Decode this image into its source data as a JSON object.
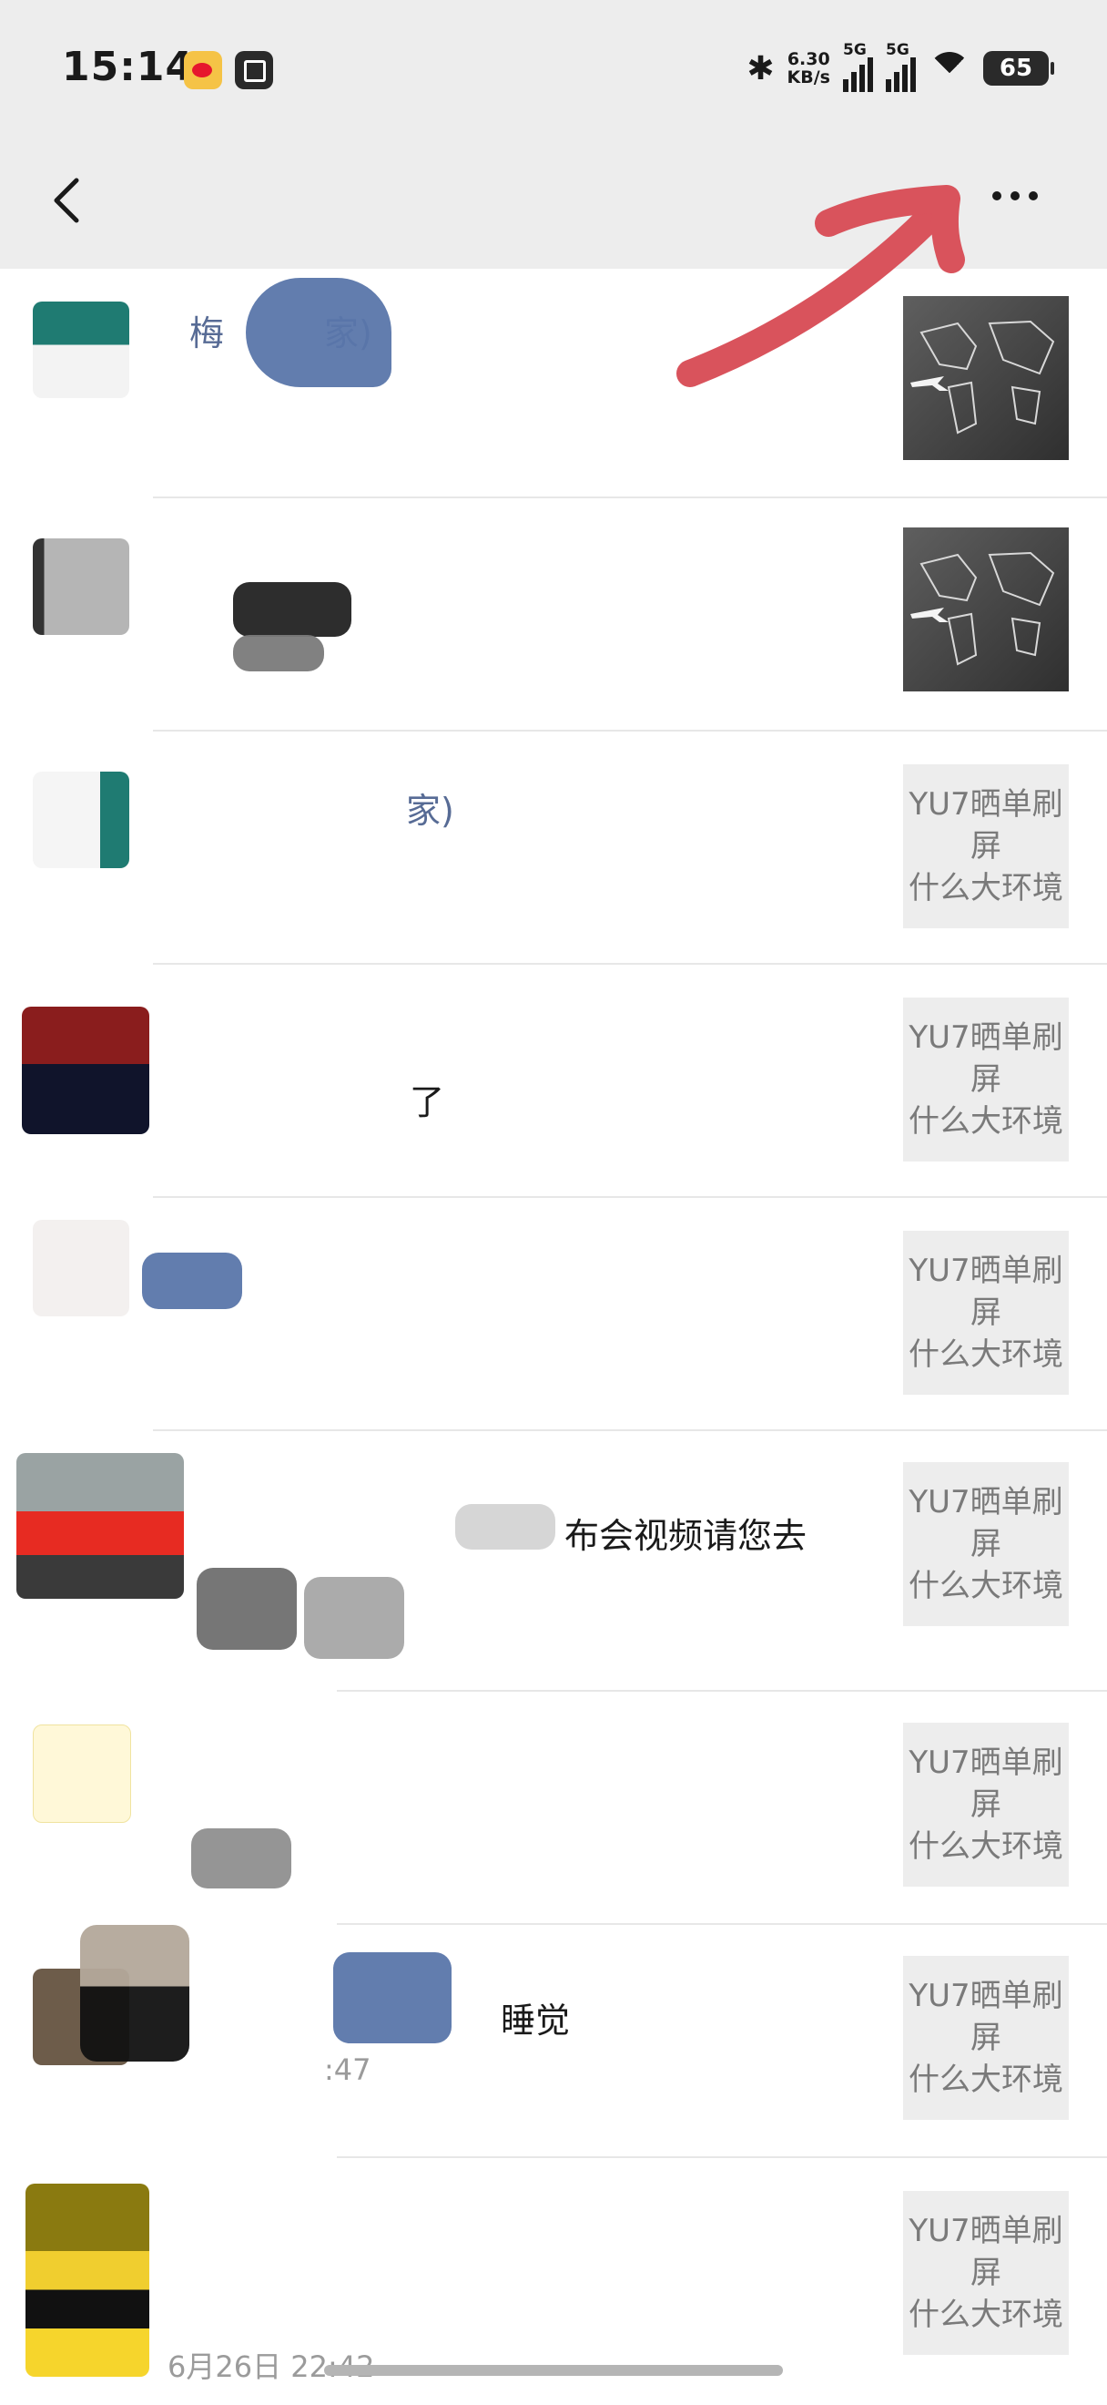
{
  "status_bar": {
    "time": "15:14",
    "bluetooth_icon": "✱",
    "net_speed_value": "6.30",
    "net_speed_unit": "KB/s",
    "signal_1_label": "5G",
    "signal_2_label": "5G",
    "battery": "65",
    "icons": [
      "weibo-icon",
      "notes-icon",
      "bluetooth-icon",
      "signal-icon",
      "wifi-icon",
      "battery-icon"
    ]
  },
  "nav": {
    "title": "",
    "back_icon": "chevron-left-icon",
    "more_icon": "more-dots-icon"
  },
  "messages": [
    {
      "name": "梅",
      "name_suffix": "家)",
      "text": "",
      "time": "",
      "thumb_type": "image",
      "thumb_text": ""
    },
    {
      "name": "",
      "name_suffix": "",
      "text": "",
      "time": "",
      "thumb_type": "image",
      "thumb_text": ""
    },
    {
      "name": "",
      "name_suffix": "家)",
      "text": "",
      "time": "",
      "thumb_type": "text",
      "thumb_text": "YU7晒单刷\n屏\n什么大环境"
    },
    {
      "name": "",
      "name_suffix": "",
      "text": "了",
      "time": "",
      "thumb_type": "text",
      "thumb_text": "YU7晒单刷\n屏\n什么大环境"
    },
    {
      "name": "",
      "name_suffix": "",
      "text": "",
      "time": "",
      "thumb_type": "text",
      "thumb_text": "YU7晒单刷\n屏\n什么大环境"
    },
    {
      "name": "",
      "name_suffix": "",
      "text": "布会视频请您去",
      "time": "",
      "thumb_type": "text",
      "thumb_text": "YU7晒单刷\n屏\n什么大环境"
    },
    {
      "name": "",
      "name_suffix": "",
      "text": "",
      "time": "",
      "thumb_type": "text",
      "thumb_text": "YU7晒单刷\n屏\n什么大环境"
    },
    {
      "name": "",
      "name_suffix": "",
      "text": "睡觉",
      "time": ":47",
      "thumb_type": "text",
      "thumb_text": "YU7晒单刷\n屏\n什么大环境"
    },
    {
      "name": "",
      "name_suffix": "",
      "text": "",
      "time": "6月26日 22:42",
      "thumb_type": "text",
      "thumb_text": "YU7晒单刷\n屏\n什么大环境"
    }
  ],
  "colors": {
    "bar_bg": "#ededed",
    "link_blue": "#576b95",
    "annotation_red": "#d9535c"
  }
}
